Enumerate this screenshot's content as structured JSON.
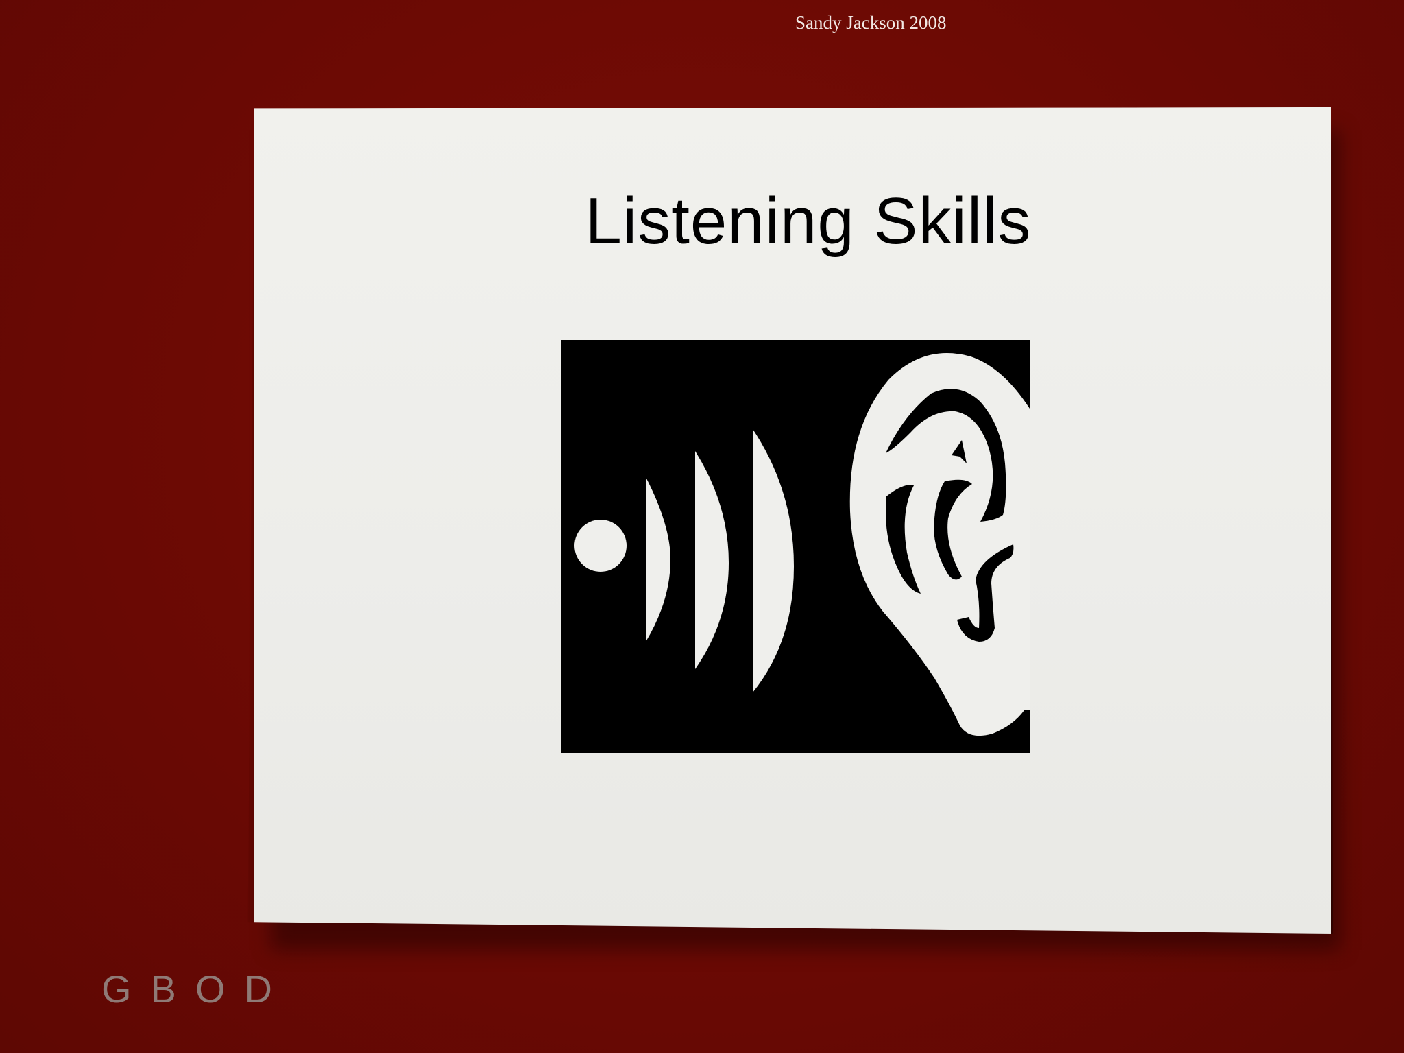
{
  "credit": "Sandy Jackson 2008",
  "slide": {
    "title": "Listening Skills",
    "illustration_icon": "ear-sound-waves-icon"
  },
  "logo": {
    "text": "GBOD"
  },
  "colors": {
    "background": "#6a0904",
    "paper": "#efefec",
    "ink": "#000000",
    "logo": "#8f7a76"
  }
}
